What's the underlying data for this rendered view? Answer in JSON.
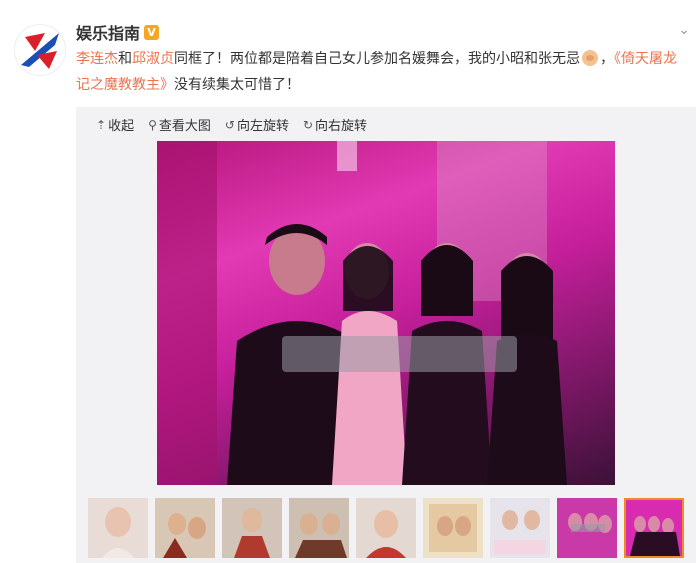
{
  "post": {
    "author": "娱乐指南",
    "verified_badge": "V",
    "mention1": "李连杰",
    "connector1": "和",
    "mention2": "邱淑贞",
    "text_after_mentions": "同框了！两位都是陪着自己女儿参加名媛舞会，我的小昭和张无忌",
    "text_after_emoji": "，",
    "topic": "《倚天屠龙记之魔教教主》",
    "text_end": "没有续集太可惜了！"
  },
  "toolbar": {
    "collapse": "收起",
    "view_large": "查看大图",
    "rotate_left": "向左旋转",
    "rotate_right": "向右旋转"
  },
  "thumbnails": {
    "count": 9,
    "selected_index": 8
  },
  "colors": {
    "link": "#eb7350",
    "badge": "#f5a623",
    "selected_border": "#f08a24",
    "media_bg": "#f2f2f5"
  },
  "icons": [
    "avatar-logo",
    "verified-icon",
    "chevron-down-icon",
    "collapse-icon",
    "search-icon",
    "rotate-left-icon",
    "rotate-right-icon",
    "smile-emoji-icon"
  ]
}
